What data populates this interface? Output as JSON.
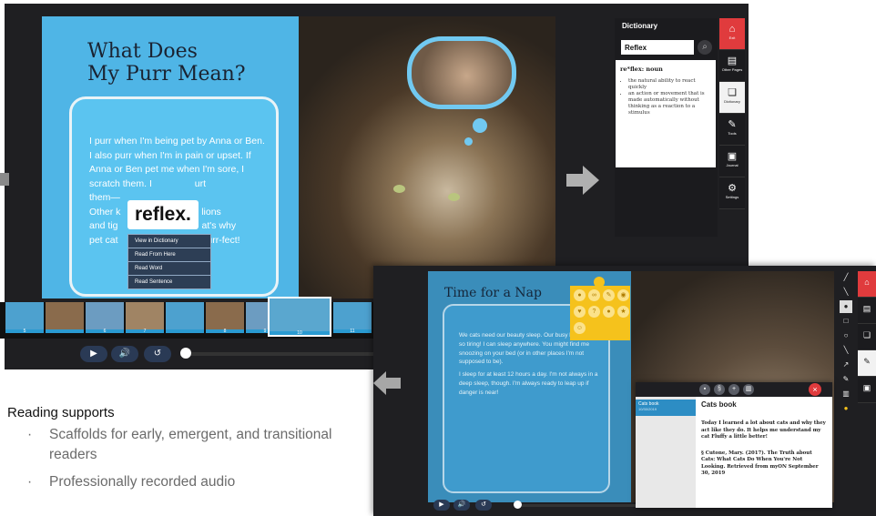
{
  "screen1": {
    "title_line1": "What Does",
    "title_line2": "My Purr Mean?",
    "body_top": "I purr when I'm being pet by Anna or Ben. I also purr when I'm in pain or upset. If Anna or Ben pet me when I'm sore, I scratch them. I",
    "body_frag1": "urt",
    "body_frag2": "them—",
    "body_frag3": "h as lions",
    "body_frag4": "Other k",
    "body_frag5": "and tig",
    "body_frag6": "at's why",
    "body_frag7": "pet cat",
    "body_frag8": "purr-fect!",
    "popup_word": "reflex.",
    "context_menu": [
      "View in Dictionary",
      "Read From Here",
      "Read Word",
      "Read Sentence"
    ],
    "thumbnail_numbers": [
      "5",
      "6",
      "7",
      "8",
      "9",
      "10",
      "11"
    ],
    "controls": {
      "play": "▶",
      "audio": "🔊",
      "replay": "↺"
    },
    "dictionary": {
      "title": "Dictionary",
      "search_value": "Reflex",
      "headword": "re*flex: noun",
      "definitions": [
        "the natural ability to react quickly",
        "an action or movement that is made automatically without thinking as a reaction to a stimulus"
      ]
    },
    "sidebar": [
      {
        "label": "Exit",
        "icon": "home-icon"
      },
      {
        "label": "Other Pages",
        "icon": "pages-icon"
      },
      {
        "label": "Dictionary",
        "icon": "dictionary-icon"
      },
      {
        "label": "Tools",
        "icon": "tools-icon"
      },
      {
        "label": "Journal",
        "icon": "journal-icon"
      },
      {
        "label": "Settings",
        "icon": "gear-icon"
      }
    ]
  },
  "caption": {
    "heading": "Reading supports",
    "bullets": [
      "Scaffolds for early, emergent, and transitional readers",
      "Professionally recorded audio"
    ]
  },
  "screen2": {
    "title": "Time for a Nap",
    "body_para1": "We cats need our beauty sleep. Our busy lives are just so tiring! I can sleep anywhere. You might find me snoozing on your bed (or in other places I'm not supposed to be).",
    "body_para2": "I sleep for at least 12 hours a day. I'm not always in a deep sleep, though. I'm always ready to leap up if danger is near!",
    "journal": {
      "list_item_title": "Cats book",
      "list_item_date": "10/30/2019",
      "entry_title": "Cats book",
      "entry_text": "Today I learned a lot about cats and why they act like they do. It helps me understand my cat Fluffy a little better!",
      "citation": "§ Cutone, Mary. (2017). The Truth about Cats: What Cats Do When You're Not Looking. Retrieved from myON September 30, 2019"
    }
  }
}
